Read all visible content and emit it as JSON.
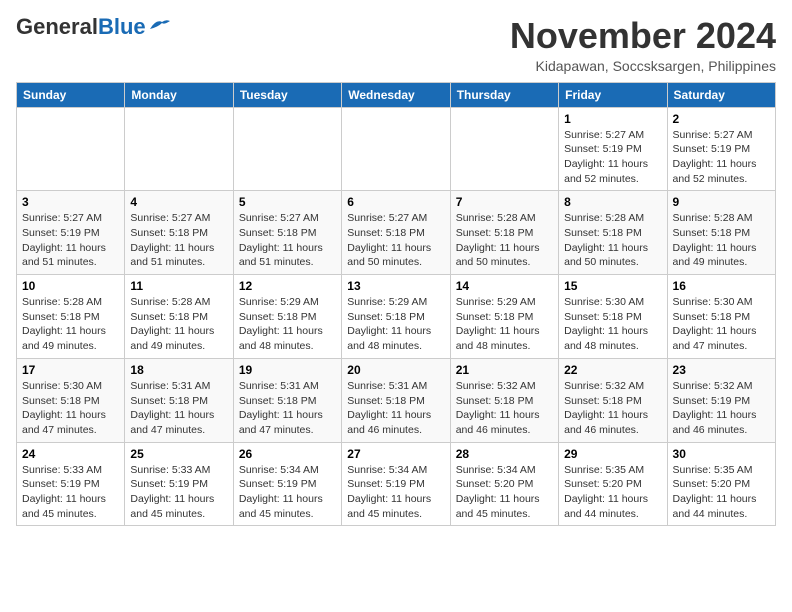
{
  "header": {
    "logo_general": "General",
    "logo_blue": "Blue",
    "month_title": "November 2024",
    "location": "Kidapawan, Soccsksargen, Philippines"
  },
  "days_of_week": [
    "Sunday",
    "Monday",
    "Tuesday",
    "Wednesday",
    "Thursday",
    "Friday",
    "Saturday"
  ],
  "weeks": [
    [
      {
        "day": "",
        "info": ""
      },
      {
        "day": "",
        "info": ""
      },
      {
        "day": "",
        "info": ""
      },
      {
        "day": "",
        "info": ""
      },
      {
        "day": "",
        "info": ""
      },
      {
        "day": "1",
        "info": "Sunrise: 5:27 AM\nSunset: 5:19 PM\nDaylight: 11 hours and 52 minutes."
      },
      {
        "day": "2",
        "info": "Sunrise: 5:27 AM\nSunset: 5:19 PM\nDaylight: 11 hours and 52 minutes."
      }
    ],
    [
      {
        "day": "3",
        "info": "Sunrise: 5:27 AM\nSunset: 5:19 PM\nDaylight: 11 hours and 51 minutes."
      },
      {
        "day": "4",
        "info": "Sunrise: 5:27 AM\nSunset: 5:18 PM\nDaylight: 11 hours and 51 minutes."
      },
      {
        "day": "5",
        "info": "Sunrise: 5:27 AM\nSunset: 5:18 PM\nDaylight: 11 hours and 51 minutes."
      },
      {
        "day": "6",
        "info": "Sunrise: 5:27 AM\nSunset: 5:18 PM\nDaylight: 11 hours and 50 minutes."
      },
      {
        "day": "7",
        "info": "Sunrise: 5:28 AM\nSunset: 5:18 PM\nDaylight: 11 hours and 50 minutes."
      },
      {
        "day": "8",
        "info": "Sunrise: 5:28 AM\nSunset: 5:18 PM\nDaylight: 11 hours and 50 minutes."
      },
      {
        "day": "9",
        "info": "Sunrise: 5:28 AM\nSunset: 5:18 PM\nDaylight: 11 hours and 49 minutes."
      }
    ],
    [
      {
        "day": "10",
        "info": "Sunrise: 5:28 AM\nSunset: 5:18 PM\nDaylight: 11 hours and 49 minutes."
      },
      {
        "day": "11",
        "info": "Sunrise: 5:28 AM\nSunset: 5:18 PM\nDaylight: 11 hours and 49 minutes."
      },
      {
        "day": "12",
        "info": "Sunrise: 5:29 AM\nSunset: 5:18 PM\nDaylight: 11 hours and 48 minutes."
      },
      {
        "day": "13",
        "info": "Sunrise: 5:29 AM\nSunset: 5:18 PM\nDaylight: 11 hours and 48 minutes."
      },
      {
        "day": "14",
        "info": "Sunrise: 5:29 AM\nSunset: 5:18 PM\nDaylight: 11 hours and 48 minutes."
      },
      {
        "day": "15",
        "info": "Sunrise: 5:30 AM\nSunset: 5:18 PM\nDaylight: 11 hours and 48 minutes."
      },
      {
        "day": "16",
        "info": "Sunrise: 5:30 AM\nSunset: 5:18 PM\nDaylight: 11 hours and 47 minutes."
      }
    ],
    [
      {
        "day": "17",
        "info": "Sunrise: 5:30 AM\nSunset: 5:18 PM\nDaylight: 11 hours and 47 minutes."
      },
      {
        "day": "18",
        "info": "Sunrise: 5:31 AM\nSunset: 5:18 PM\nDaylight: 11 hours and 47 minutes."
      },
      {
        "day": "19",
        "info": "Sunrise: 5:31 AM\nSunset: 5:18 PM\nDaylight: 11 hours and 47 minutes."
      },
      {
        "day": "20",
        "info": "Sunrise: 5:31 AM\nSunset: 5:18 PM\nDaylight: 11 hours and 46 minutes."
      },
      {
        "day": "21",
        "info": "Sunrise: 5:32 AM\nSunset: 5:18 PM\nDaylight: 11 hours and 46 minutes."
      },
      {
        "day": "22",
        "info": "Sunrise: 5:32 AM\nSunset: 5:18 PM\nDaylight: 11 hours and 46 minutes."
      },
      {
        "day": "23",
        "info": "Sunrise: 5:32 AM\nSunset: 5:19 PM\nDaylight: 11 hours and 46 minutes."
      }
    ],
    [
      {
        "day": "24",
        "info": "Sunrise: 5:33 AM\nSunset: 5:19 PM\nDaylight: 11 hours and 45 minutes."
      },
      {
        "day": "25",
        "info": "Sunrise: 5:33 AM\nSunset: 5:19 PM\nDaylight: 11 hours and 45 minutes."
      },
      {
        "day": "26",
        "info": "Sunrise: 5:34 AM\nSunset: 5:19 PM\nDaylight: 11 hours and 45 minutes."
      },
      {
        "day": "27",
        "info": "Sunrise: 5:34 AM\nSunset: 5:19 PM\nDaylight: 11 hours and 45 minutes."
      },
      {
        "day": "28",
        "info": "Sunrise: 5:34 AM\nSunset: 5:20 PM\nDaylight: 11 hours and 45 minutes."
      },
      {
        "day": "29",
        "info": "Sunrise: 5:35 AM\nSunset: 5:20 PM\nDaylight: 11 hours and 44 minutes."
      },
      {
        "day": "30",
        "info": "Sunrise: 5:35 AM\nSunset: 5:20 PM\nDaylight: 11 hours and 44 minutes."
      }
    ]
  ]
}
